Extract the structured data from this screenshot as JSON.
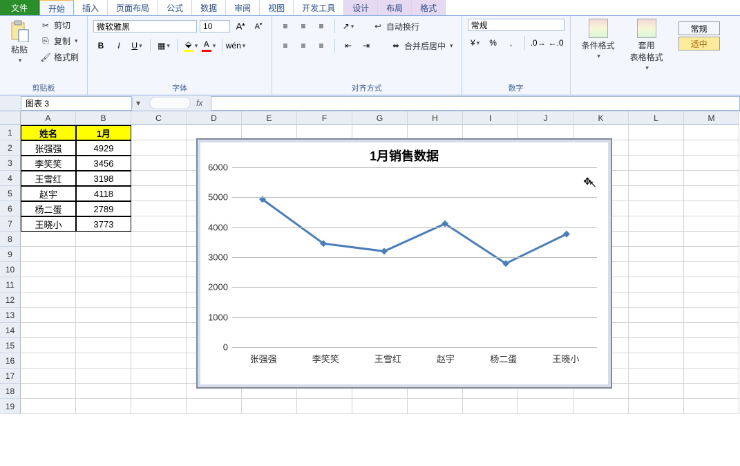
{
  "tabs": {
    "file": "文件",
    "list": [
      "开始",
      "插入",
      "页面布局",
      "公式",
      "数据",
      "审阅",
      "视图",
      "开发工具"
    ],
    "context": [
      "设计",
      "布局",
      "格式"
    ],
    "active": "开始"
  },
  "ribbon": {
    "clipboard": {
      "paste": "粘贴",
      "cut": "剪切",
      "copy": "复制",
      "fmtpaint": "格式刷",
      "label": "剪贴板"
    },
    "font": {
      "name": "微软雅黑",
      "size": "10",
      "bold": "B",
      "italic": "I",
      "underline": "U",
      "label": "字体"
    },
    "align": {
      "wrap": "自动换行",
      "merge": "合并后居中",
      "label": "对齐方式"
    },
    "number": {
      "format": "常规",
      "label": "数字"
    },
    "styles": {
      "condfmt": "条件格式",
      "tablefmt": "套用\n表格格式",
      "label": ""
    },
    "cellstyles": {
      "normal": "常规",
      "good": "适中"
    }
  },
  "fbar": {
    "name": "图表 3",
    "fx": "fx"
  },
  "columns": [
    "A",
    "B",
    "C",
    "D",
    "E",
    "F",
    "G",
    "H",
    "I",
    "J",
    "K",
    "L",
    "M"
  ],
  "rows": [
    "1",
    "2",
    "3",
    "4",
    "5",
    "6",
    "7",
    "8",
    "9",
    "10",
    "11",
    "12",
    "13",
    "14",
    "15",
    "16",
    "17",
    "18",
    "19"
  ],
  "table": {
    "headers": [
      "姓名",
      "1月"
    ],
    "rows": [
      [
        "张强强",
        "4929"
      ],
      [
        "李笑笑",
        "3456"
      ],
      [
        "王雪红",
        "3198"
      ],
      [
        "赵宇",
        "4118"
      ],
      [
        "杨二蛋",
        "2789"
      ],
      [
        "王晓小",
        "3773"
      ]
    ]
  },
  "chart_data": {
    "type": "line",
    "title": "1月销售数据",
    "categories": [
      "张强强",
      "李笑笑",
      "王雪红",
      "赵宇",
      "杨二蛋",
      "王晓小"
    ],
    "values": [
      4929,
      3456,
      3198,
      4118,
      2789,
      3773
    ],
    "ylim": [
      0,
      6000
    ],
    "yticks": [
      0,
      1000,
      2000,
      3000,
      4000,
      5000,
      6000
    ]
  },
  "col_widths": {
    "A": 80,
    "B": 80,
    "other": 80
  }
}
